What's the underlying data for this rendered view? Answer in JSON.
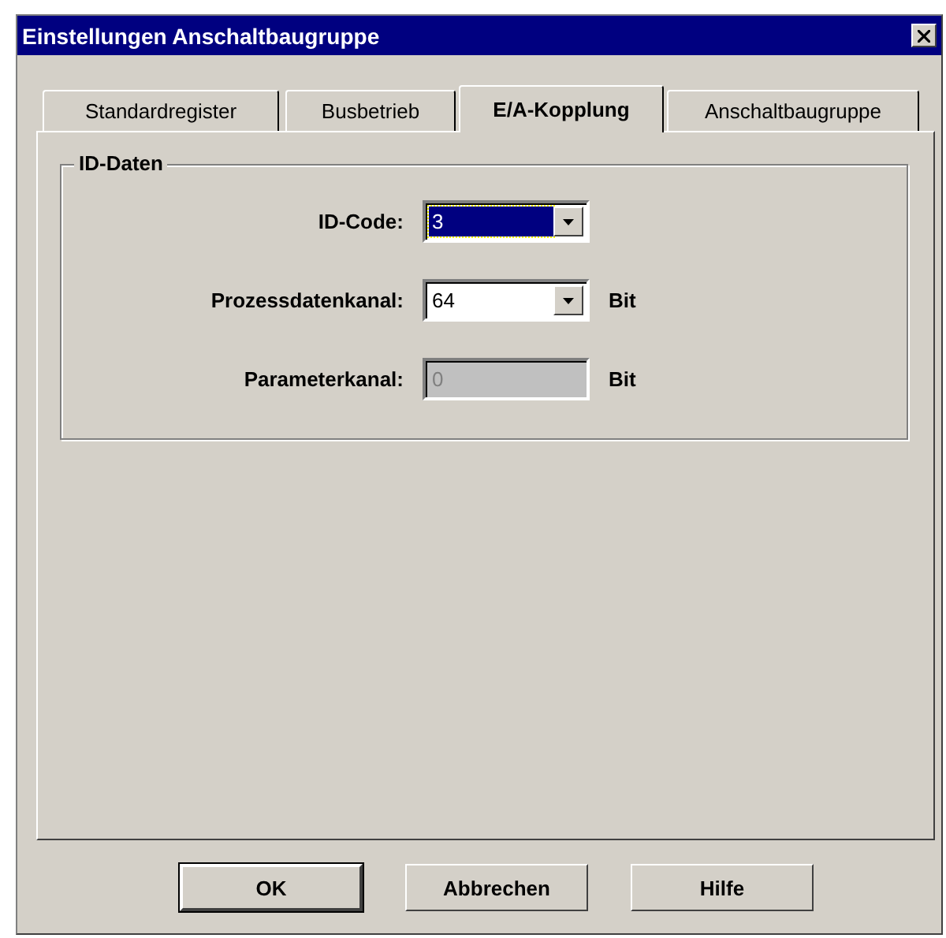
{
  "window": {
    "title": "Einstellungen Anschaltbaugruppe"
  },
  "tabs": [
    {
      "label": "Standardregister",
      "selected": false
    },
    {
      "label": "Busbetrieb",
      "selected": false
    },
    {
      "label": "E/A-Kopplung",
      "selected": true
    },
    {
      "label": "Anschaltbaugruppe",
      "selected": false
    }
  ],
  "group": {
    "title": "ID-Daten",
    "fields": [
      {
        "kind": "dropdown",
        "label": "ID-Code:",
        "value": "3",
        "focused": true,
        "disabled": false
      },
      {
        "kind": "dropdown",
        "label": "Prozessdatenkanal:",
        "value": "64",
        "unit": "Bit",
        "focused": false,
        "disabled": false
      },
      {
        "kind": "text",
        "label": "Parameterkanal:",
        "value": "0",
        "unit": "Bit",
        "focused": false,
        "disabled": true
      }
    ]
  },
  "buttons": [
    {
      "label": "OK",
      "default": true
    },
    {
      "label": "Abbrechen",
      "default": false
    },
    {
      "label": "Hilfe",
      "default": false
    }
  ]
}
